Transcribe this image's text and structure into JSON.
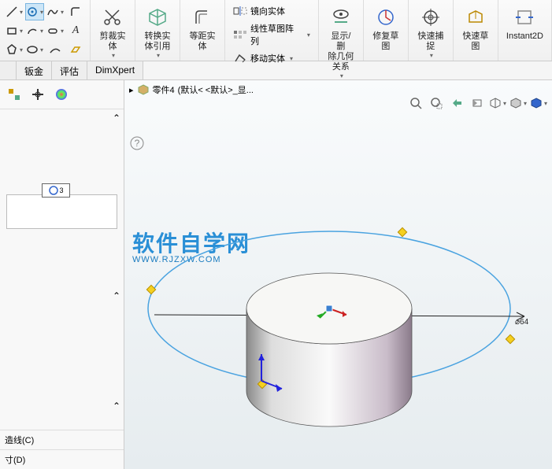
{
  "ribbon": {
    "trim": "剪裁实\n体",
    "convert": "转换实\n体引用",
    "offset": "等距实\n体",
    "mirror": "镜向实体",
    "linear_pattern": "线性草图阵列",
    "move": "移动实体",
    "display_rel": "显示/删\n除几何\n关系",
    "repair": "修复草\n图",
    "quick_snap": "快速捕\n捉",
    "quick_sketch": "快速草\n图",
    "instant2d": "Instant2D"
  },
  "tabs": {
    "sheet_metal": "钣金",
    "evaluate": "评估",
    "dimxpert": "DimXpert"
  },
  "breadcrumb": {
    "part": "零件4",
    "config": "(默认< <默认>_显..."
  },
  "watermark": {
    "title": "软件自学网",
    "url": "WWW.RJZXW.COM"
  },
  "panel": {
    "dim_badge": "3",
    "construction": "造线(C)",
    "inch": "寸(D)"
  },
  "dimension": {
    "value": "⌀64"
  }
}
